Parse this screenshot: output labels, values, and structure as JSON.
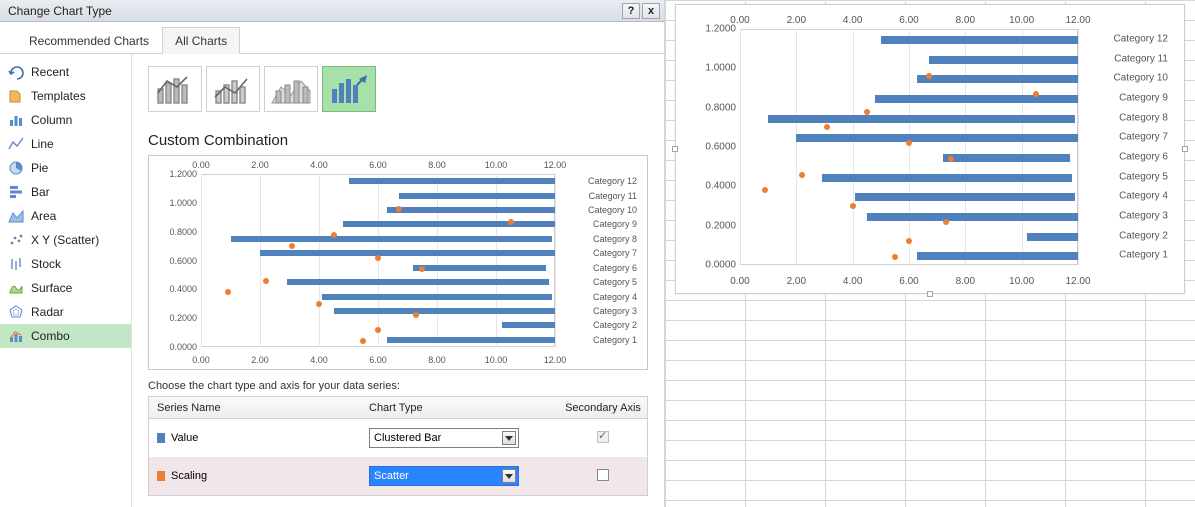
{
  "titlebar": {
    "title": "Change Chart Type",
    "help": "?",
    "close": "x"
  },
  "tabs": {
    "recommended": "Recommended Charts",
    "all": "All Charts",
    "active": "all"
  },
  "sidebar": {
    "items": [
      {
        "id": "recent",
        "label": "Recent"
      },
      {
        "id": "templates",
        "label": "Templates"
      },
      {
        "id": "column",
        "label": "Column"
      },
      {
        "id": "line",
        "label": "Line"
      },
      {
        "id": "pie",
        "label": "Pie"
      },
      {
        "id": "bar",
        "label": "Bar"
      },
      {
        "id": "area",
        "label": "Area"
      },
      {
        "id": "scatter",
        "label": "X Y (Scatter)"
      },
      {
        "id": "stock",
        "label": "Stock"
      },
      {
        "id": "surface",
        "label": "Surface"
      },
      {
        "id": "radar",
        "label": "Radar"
      },
      {
        "id": "combo",
        "label": "Combo"
      }
    ],
    "selected": "combo"
  },
  "main": {
    "section_title": "Custom Combination",
    "series_label": "Choose the chart type and axis for your data series:",
    "table": {
      "col_series": "Series Name",
      "col_type": "Chart Type",
      "col_axis": "Secondary Axis",
      "rows": [
        {
          "name": "Value",
          "swatch": "blue",
          "type": "Clustered Bar",
          "secondary": true,
          "selected": false
        },
        {
          "name": "Scaling",
          "swatch": "orange",
          "type": "Scatter",
          "secondary": false,
          "selected": true
        }
      ]
    }
  },
  "chart_data": {
    "type": "bar",
    "xlabel": "",
    "ylabel": "",
    "x_axis": {
      "min": 0,
      "max": 12,
      "ticks": [
        "0.00",
        "2.00",
        "4.00",
        "6.00",
        "8.00",
        "10.00",
        "12.00"
      ]
    },
    "y_axis": {
      "min": 0,
      "max": 1.2,
      "ticks": [
        "0.0000",
        "0.2000",
        "0.4000",
        "0.6000",
        "0.8000",
        "1.0000",
        "1.2000"
      ]
    },
    "categories": [
      "Category 1",
      "Category 2",
      "Category 3",
      "Category 4",
      "Category 5",
      "Category 6",
      "Category 7",
      "Category 8",
      "Category 9",
      "Category 10",
      "Category 11",
      "Category 12"
    ],
    "series": [
      {
        "name": "Value",
        "type": "bar",
        "color": "#4f81bd",
        "bars": [
          {
            "start": 6.3,
            "end": 12.0
          },
          {
            "start": 10.2,
            "end": 12.0
          },
          {
            "start": 4.5,
            "end": 12.1
          },
          {
            "start": 4.1,
            "end": 11.9
          },
          {
            "start": 2.9,
            "end": 11.8
          },
          {
            "start": 7.2,
            "end": 11.7
          },
          {
            "start": 2.0,
            "end": 12.0
          },
          {
            "start": 1.0,
            "end": 11.9
          },
          {
            "start": 4.8,
            "end": 12.2
          },
          {
            "start": 6.3,
            "end": 12.6
          },
          {
            "start": 6.7,
            "end": 12.0
          },
          {
            "start": 5.0,
            "end": 12.0
          }
        ]
      },
      {
        "name": "Scaling",
        "type": "scatter",
        "color": "#ed7d31",
        "points": [
          {
            "x": 5.5,
            "y": 0.04
          },
          {
            "x": 6.0,
            "y": 0.12
          },
          {
            "x": 7.3,
            "y": 0.22
          },
          {
            "x": 4.0,
            "y": 0.3
          },
          {
            "x": 0.9,
            "y": 0.38
          },
          {
            "x": 2.2,
            "y": 0.46
          },
          {
            "x": 7.5,
            "y": 0.54
          },
          {
            "x": 6.0,
            "y": 0.62
          },
          {
            "x": 3.1,
            "y": 0.7
          },
          {
            "x": 4.5,
            "y": 0.78
          },
          {
            "x": 10.5,
            "y": 0.87
          },
          {
            "x": 6.7,
            "y": 0.96
          }
        ]
      }
    ]
  }
}
